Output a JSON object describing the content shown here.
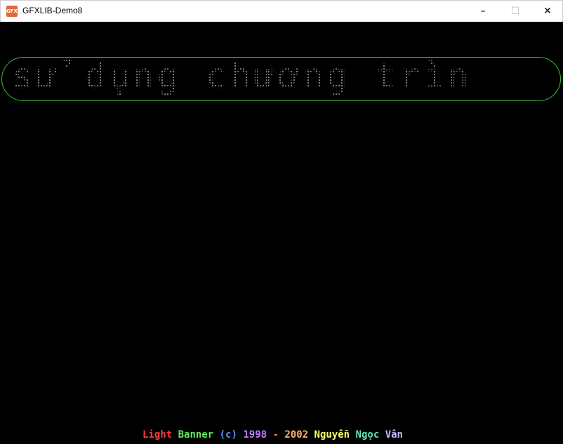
{
  "window": {
    "title": "GFXLIB-Demo8",
    "app_icon": "gfxlib-app-icon",
    "app_icon_text": "GFX",
    "controls": {
      "minimize": "–",
      "maximize": "☐",
      "close": "✕"
    }
  },
  "banner": {
    "text": "sử dụng chương trìn",
    "border_color": "#39c03c",
    "dot_color": "#b0b0b0"
  },
  "credits": {
    "segments": [
      {
        "text": "Light",
        "color": "#ff3b3b"
      },
      {
        "text": " ",
        "color": "#ffffff"
      },
      {
        "text": "Banner",
        "color": "#5cf05c"
      },
      {
        "text": " ",
        "color": "#ffffff"
      },
      {
        "text": "(c)",
        "color": "#5b8cff"
      },
      {
        "text": " ",
        "color": "#ffffff"
      },
      {
        "text": "1998",
        "color": "#c07cff"
      },
      {
        "text": " - ",
        "color": "#ff6b6b"
      },
      {
        "text": "2002",
        "color": "#ffb070"
      },
      {
        "text": " ",
        "color": "#ffffff"
      },
      {
        "text": "Nguyễn",
        "color": "#ffff66"
      },
      {
        "text": " ",
        "color": "#ffffff"
      },
      {
        "text": "Ngọc",
        "color": "#66e0c0"
      },
      {
        "text": " ",
        "color": "#ffffff"
      },
      {
        "text": "Vân",
        "color": "#c8b8ff"
      }
    ]
  }
}
